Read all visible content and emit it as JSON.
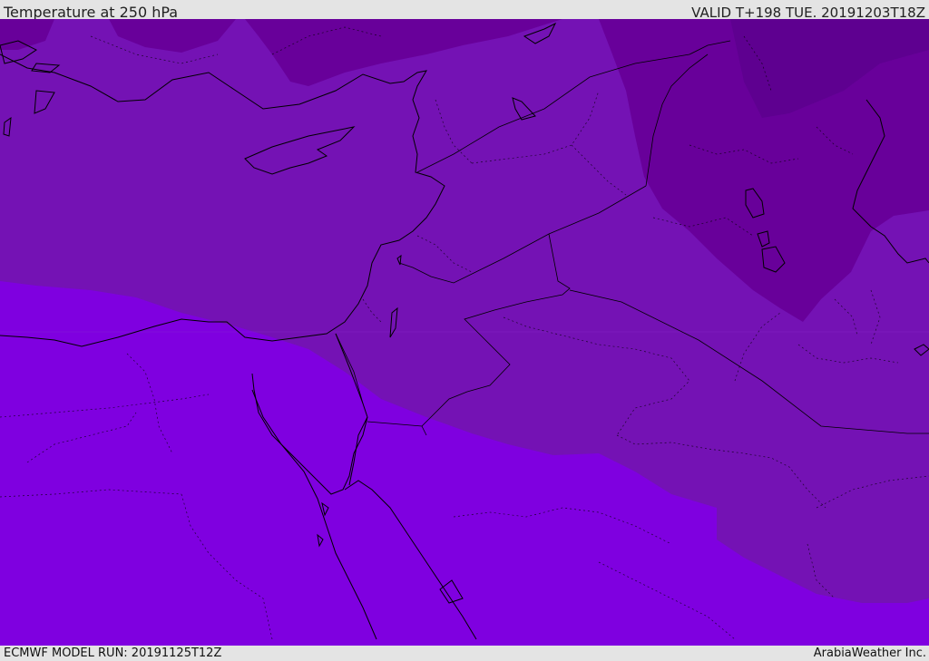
{
  "header": {
    "title": "Temperature at 250 hPa",
    "valid": "VALID T+198 TUE. 20191203T18Z"
  },
  "footer": {
    "model_run": "ECMWF MODEL RUN: 20191125T12Z",
    "credit": "ArabiaWeather Inc."
  },
  "map": {
    "variable": "temperature",
    "level": "250 hPa",
    "colors": {
      "coldest": "#5e0090",
      "cold": "#68009a",
      "mid": "#7412b4",
      "mild": "#7a0ece",
      "warm": "#7f00e0",
      "coastline": "#000000"
    }
  }
}
